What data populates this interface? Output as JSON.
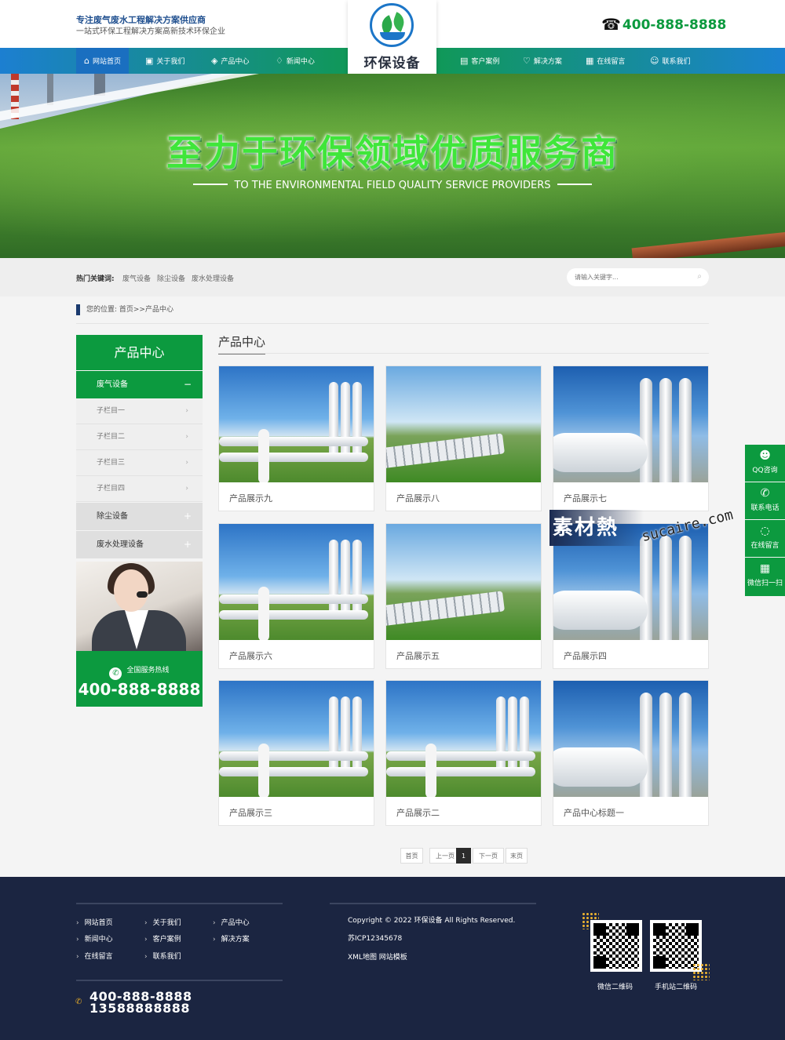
{
  "header": {
    "slogan_main": "专注废气废水工程解决方案供应商",
    "slogan_sub": "一站式环保工程解决方案高新技术环保企业",
    "logo_text": "环保设备",
    "phone": "400-888-8888"
  },
  "nav": {
    "items": [
      {
        "label": "网站首页",
        "icon": "home-icon"
      },
      {
        "label": "关于我们",
        "icon": "grid-icon"
      },
      {
        "label": "产品中心",
        "icon": "layers-icon"
      },
      {
        "label": "新闻中心",
        "icon": "bulb-icon"
      },
      {
        "label": "客户案例",
        "icon": "document-icon"
      },
      {
        "label": "解决方案",
        "icon": "handshake-icon"
      },
      {
        "label": "在线留言",
        "icon": "notes-icon"
      },
      {
        "label": "联系我们",
        "icon": "person-icon"
      }
    ],
    "active": "网站首页"
  },
  "banner": {
    "title": "至力于环保领域优质服务商",
    "subtitle": "TO THE ENVIRONMENTAL FIELD QUALITY SERVICE PROVIDERS"
  },
  "keywords": {
    "label": "热门关键词:",
    "items": [
      "废气设备",
      "除尘设备",
      "废水处理设备"
    ]
  },
  "search": {
    "placeholder": "请输入关键字..."
  },
  "breadcrumb": {
    "text": "您的位置: 首页>>产品中心"
  },
  "sidebar": {
    "title": "产品中心",
    "categories": [
      {
        "label": "废气设备",
        "sign": "−",
        "subs": [
          "子栏目一",
          "子栏目二",
          "子栏目三",
          "子栏目四"
        ]
      },
      {
        "label": "除尘设备",
        "sign": "+"
      },
      {
        "label": "废水处理设备",
        "sign": "+"
      }
    ],
    "hotline_label": "全国服务热线",
    "hotline_number": "400-888-8888"
  },
  "main": {
    "title": "产品中心",
    "products": [
      {
        "caption": "产品展示九",
        "image": "industrial-pipes"
      },
      {
        "caption": "产品展示八",
        "image": "pipeline-field"
      },
      {
        "caption": "产品展示七",
        "image": "tanks-closeup"
      },
      {
        "caption": "产品展示六",
        "image": "industrial-pipes"
      },
      {
        "caption": "产品展示五",
        "image": "pipeline-field"
      },
      {
        "caption": "产品展示四",
        "image": "tanks-closeup"
      },
      {
        "caption": "产品展示三",
        "image": "industrial-pipes"
      },
      {
        "caption": "产品展示二",
        "image": "industrial-pipes"
      },
      {
        "caption": "产品中心标题一",
        "image": "tanks-closeup"
      }
    ]
  },
  "pager": {
    "first": "首页",
    "prev": "上一页",
    "current": "1",
    "next": "下一页",
    "last": "末页"
  },
  "float_bar": [
    {
      "label": "QQ咨询",
      "icon": "qq-icon"
    },
    {
      "label": "联系电话",
      "icon": "phone-icon"
    },
    {
      "label": "在线留言",
      "icon": "message-icon"
    },
    {
      "label": "微信扫一扫",
      "icon": "qrcode-icon"
    }
  ],
  "watermark": {
    "cn": "素材熱",
    "url": "sucaire.com"
  },
  "footer": {
    "links": [
      "网站首页",
      "关于我们",
      "产品中心",
      "新闻中心",
      "客户案例",
      "解决方案",
      "在线留言",
      "联系我们"
    ],
    "phone1": "400-888-8888",
    "phone2": "13588888888",
    "copyright": "Copyright © 2022 环保设备 All Rights Reserved.",
    "icp": "苏ICP12345678",
    "sitemap": "XML地图 网站模板",
    "qr_wechat": "微信二维码",
    "qr_mobile": "手机站二维码"
  },
  "colors": {
    "green": "#0c9a3f",
    "blue": "#1c7fd1",
    "navy": "#1b2541"
  }
}
